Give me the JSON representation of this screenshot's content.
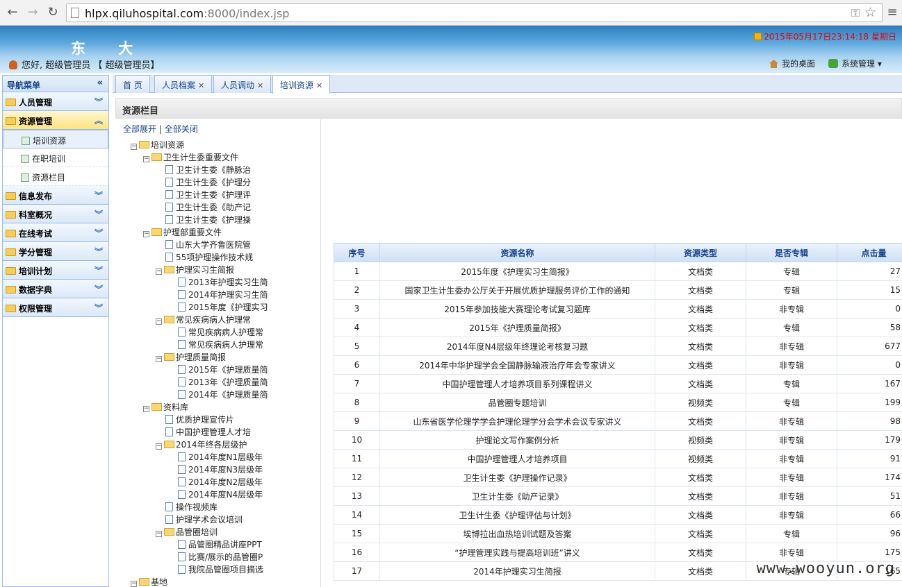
{
  "browser": {
    "url_host": "hlpx.qiluhospital.com",
    "url_rest": ":8000/index.jsp"
  },
  "header": {
    "title": "东 大",
    "datetime": "2015年05月17日23:14:18 星期日",
    "welcome": "您好, 超级管理员 【 超级管理员】",
    "my_desktop": "我的桌面",
    "system_admin": "系统管理"
  },
  "sidebar": {
    "title": "导航菜单",
    "groups": [
      {
        "label": "人员管理"
      },
      {
        "label": "资源管理"
      },
      {
        "label": "信息发布"
      },
      {
        "label": "科室概况"
      },
      {
        "label": "在线考试"
      },
      {
        "label": "学分管理"
      },
      {
        "label": "培训计划"
      },
      {
        "label": "数据字典"
      },
      {
        "label": "权限管理"
      }
    ],
    "subitems": [
      {
        "label": "培训资源"
      },
      {
        "label": "在职培训"
      },
      {
        "label": "资源栏目"
      }
    ]
  },
  "tabs": [
    {
      "label": "首 页"
    },
    {
      "label": "人员档案"
    },
    {
      "label": "人员调动"
    },
    {
      "label": "培训资源"
    }
  ],
  "panel": {
    "title": "资源栏目",
    "expand_all": "全部展开",
    "separator": "|",
    "collapse_all": "全部关闭"
  },
  "tree": [
    {
      "label": "培训资源",
      "type": "folder"
    },
    {
      "label": "卫生计生委重要文件",
      "type": "folder"
    },
    {
      "label": "卫生计生委《静脉治",
      "type": "doc"
    },
    {
      "label": "卫生计生委《护理分",
      "type": "doc"
    },
    {
      "label": "卫生计生委《护理评",
      "type": "doc"
    },
    {
      "label": "卫生计生委《助产记",
      "type": "doc"
    },
    {
      "label": "卫生计生委《护理操",
      "type": "doc"
    },
    {
      "label": "护理部重要文件",
      "type": "folder"
    },
    {
      "label": "山东大学齐鲁医院管",
      "type": "doc"
    },
    {
      "label": "55项护理操作技术规",
      "type": "doc"
    },
    {
      "label": "护理实习生简报",
      "type": "folder"
    },
    {
      "label": "2013年护理实习生简",
      "type": "doc"
    },
    {
      "label": "2014年护理实习生简",
      "type": "doc"
    },
    {
      "label": "2015年度《护理实习",
      "type": "doc"
    },
    {
      "label": "常见疾病病人护理常",
      "type": "folder"
    },
    {
      "label": "常见疾病病人护理常",
      "type": "doc"
    },
    {
      "label": "常见疾病病人护理常",
      "type": "doc"
    },
    {
      "label": "护理质量简报",
      "type": "folder"
    },
    {
      "label": "2015年《护理质量简",
      "type": "doc"
    },
    {
      "label": "2013年《护理质量简",
      "type": "doc"
    },
    {
      "label": "2014年《护理质量简",
      "type": "doc"
    },
    {
      "label": "资料库",
      "type": "folder"
    },
    {
      "label": "优质护理宣传片",
      "type": "doc"
    },
    {
      "label": "中国护理管理人才培",
      "type": "doc"
    },
    {
      "label": "2014年终各层级护",
      "type": "folder"
    },
    {
      "label": "2014年度N1层级年",
      "type": "doc"
    },
    {
      "label": "2014年度N3层级年",
      "type": "doc"
    },
    {
      "label": "2014年度N2层级年",
      "type": "doc"
    },
    {
      "label": "2014年度N4层级年",
      "type": "doc"
    },
    {
      "label": "操作视频库",
      "type": "doc"
    },
    {
      "label": "护理学术会议培训",
      "type": "doc"
    },
    {
      "label": "品管圈培训",
      "type": "folder"
    },
    {
      "label": "品管圈精品讲座PPT",
      "type": "doc"
    },
    {
      "label": "比赛/展示的品管圈P",
      "type": "doc"
    },
    {
      "label": "我院品管圈项目摘选",
      "type": "doc"
    },
    {
      "label": "基地",
      "type": "folder"
    }
  ],
  "grid": {
    "headers": [
      "序号",
      "资源名称",
      "资源类型",
      "是否专辑",
      "点击量"
    ],
    "rows": [
      [
        "1",
        "2015年度《护理实习生简报》",
        "文档类",
        "专辑",
        "27"
      ],
      [
        "2",
        "国家卫生计生委办公厅关于开展优质护理服务评价工作的通知",
        "文档类",
        "专辑",
        "15"
      ],
      [
        "3",
        "2015年参加技能大赛理论考试复习题库",
        "文档类",
        "非专辑",
        "0"
      ],
      [
        "4",
        "2015年《护理质量简报》",
        "文档类",
        "专辑",
        "58"
      ],
      [
        "5",
        "2014年度N4层级年终理论考核复习题",
        "文档类",
        "非专辑",
        "677"
      ],
      [
        "6",
        "2014年中华护理学会全国静脉输液治疗年会专家讲义",
        "文档类",
        "非专辑",
        "0"
      ],
      [
        "7",
        "中国护理管理人才培养项目系列课程讲义",
        "文档类",
        "专辑",
        "167"
      ],
      [
        "8",
        "品管圈专题培训",
        "视频类",
        "专辑",
        "199"
      ],
      [
        "9",
        "山东省医学伦理学学会护理伦理学分会学术会议专家讲义",
        "文档类",
        "非专辑",
        "98"
      ],
      [
        "10",
        "护理论文写作案例分析",
        "视频类",
        "非专辑",
        "179"
      ],
      [
        "11",
        "中国护理管理人才培养项目",
        "视频类",
        "非专辑",
        "91"
      ],
      [
        "12",
        "卫生计生委《护理操作记录》",
        "文档类",
        "非专辑",
        "174"
      ],
      [
        "13",
        "卫生计生委《助产记录》",
        "文档类",
        "非专辑",
        "51"
      ],
      [
        "14",
        "卫生计生委《护理评估与计划》",
        "文档类",
        "非专辑",
        "66"
      ],
      [
        "15",
        "埃博拉出血热培训试题及答案",
        "文档类",
        "专辑",
        "96"
      ],
      [
        "16",
        "“护理管理实践与提高培训班”讲义",
        "文档类",
        "非专辑",
        "175"
      ],
      [
        "17",
        "2014年护理实习生简报",
        "文档类",
        "专辑",
        "165"
      ]
    ]
  },
  "watermark": "www.wooyun.org"
}
